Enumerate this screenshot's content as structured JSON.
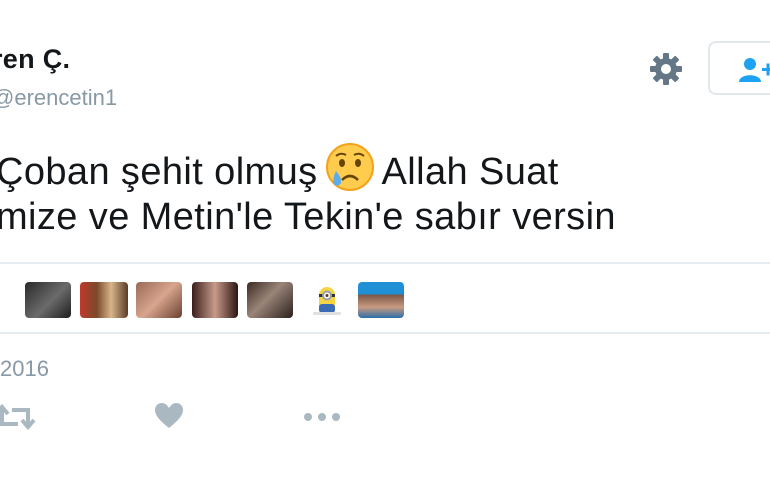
{
  "user": {
    "display_name": "ren Ç.",
    "handle": "erencetin1"
  },
  "tweet": {
    "line1_a": "Çoban şehit olmuş",
    "line1_b": "Allah Suat",
    "line2": "mize ve Metin'le Tekin'e sabır versin",
    "emoji": "crying-face-emoji"
  },
  "likers": [
    "avatar-1",
    "avatar-2",
    "avatar-3",
    "avatar-4",
    "avatar-5",
    "avatar-minion",
    "avatar-7"
  ],
  "meta": {
    "date": "2016"
  },
  "colors": {
    "accent": "#1da1f2",
    "muted": "#8899a6",
    "text": "#14171a",
    "border": "#e6ecf0"
  }
}
